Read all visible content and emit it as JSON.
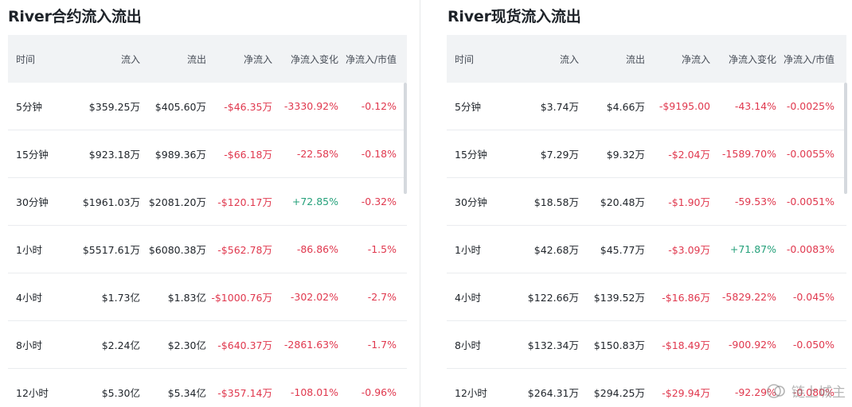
{
  "colors": {
    "negative": "#e0384e",
    "positive": "#26a17b",
    "header_bg": "#f1f3f5"
  },
  "left": {
    "title": "River合约流入流出",
    "headers": [
      "时间",
      "流入",
      "流出",
      "净流入",
      "净流入变化",
      "净流入/市值"
    ],
    "rows": [
      {
        "time": "5分钟",
        "inflow": "$359.25万",
        "outflow": "$405.60万",
        "net": "-$46.35万",
        "change": "-3330.92%",
        "ratio": "-0.12%"
      },
      {
        "time": "15分钟",
        "inflow": "$923.18万",
        "outflow": "$989.36万",
        "net": "-$66.18万",
        "change": "-22.58%",
        "ratio": "-0.18%"
      },
      {
        "time": "30分钟",
        "inflow": "$1961.03万",
        "outflow": "$2081.20万",
        "net": "-$120.17万",
        "change": "+72.85%",
        "ratio": "-0.32%"
      },
      {
        "time": "1小时",
        "inflow": "$5517.61万",
        "outflow": "$6080.38万",
        "net": "-$562.78万",
        "change": "-86.86%",
        "ratio": "-1.5%"
      },
      {
        "time": "4小时",
        "inflow": "$1.73亿",
        "outflow": "$1.83亿",
        "net": "-$1000.76万",
        "change": "-302.02%",
        "ratio": "-2.7%"
      },
      {
        "time": "8小时",
        "inflow": "$2.24亿",
        "outflow": "$2.30亿",
        "net": "-$640.37万",
        "change": "-2861.63%",
        "ratio": "-1.7%"
      },
      {
        "time": "12小时",
        "inflow": "$5.30亿",
        "outflow": "$5.34亿",
        "net": "-$357.14万",
        "change": "-108.01%",
        "ratio": "-0.96%"
      }
    ]
  },
  "right": {
    "title": "River现货流入流出",
    "headers": [
      "时间",
      "流入",
      "流出",
      "净流入",
      "净流入变化",
      "净流入/市值"
    ],
    "rows": [
      {
        "time": "5分钟",
        "inflow": "$3.74万",
        "outflow": "$4.66万",
        "net": "-$9195.00",
        "change": "-43.14%",
        "ratio": "-0.0025%"
      },
      {
        "time": "15分钟",
        "inflow": "$7.29万",
        "outflow": "$9.32万",
        "net": "-$2.04万",
        "change": "-1589.70%",
        "ratio": "-0.0055%"
      },
      {
        "time": "30分钟",
        "inflow": "$18.58万",
        "outflow": "$20.48万",
        "net": "-$1.90万",
        "change": "-59.53%",
        "ratio": "-0.0051%"
      },
      {
        "time": "1小时",
        "inflow": "$42.68万",
        "outflow": "$45.77万",
        "net": "-$3.09万",
        "change": "+71.87%",
        "ratio": "-0.0083%"
      },
      {
        "time": "4小时",
        "inflow": "$122.66万",
        "outflow": "$139.52万",
        "net": "-$16.86万",
        "change": "-5829.22%",
        "ratio": "-0.045%"
      },
      {
        "time": "8小时",
        "inflow": "$132.34万",
        "outflow": "$150.83万",
        "net": "-$18.49万",
        "change": "-900.92%",
        "ratio": "-0.050%"
      },
      {
        "time": "12小时",
        "inflow": "$264.31万",
        "outflow": "$294.25万",
        "net": "-$29.94万",
        "change": "-92.29%",
        "ratio": "-0.080%"
      }
    ]
  },
  "watermark": {
    "icon": "blockchain-logo-icon",
    "text": "链上城主"
  }
}
